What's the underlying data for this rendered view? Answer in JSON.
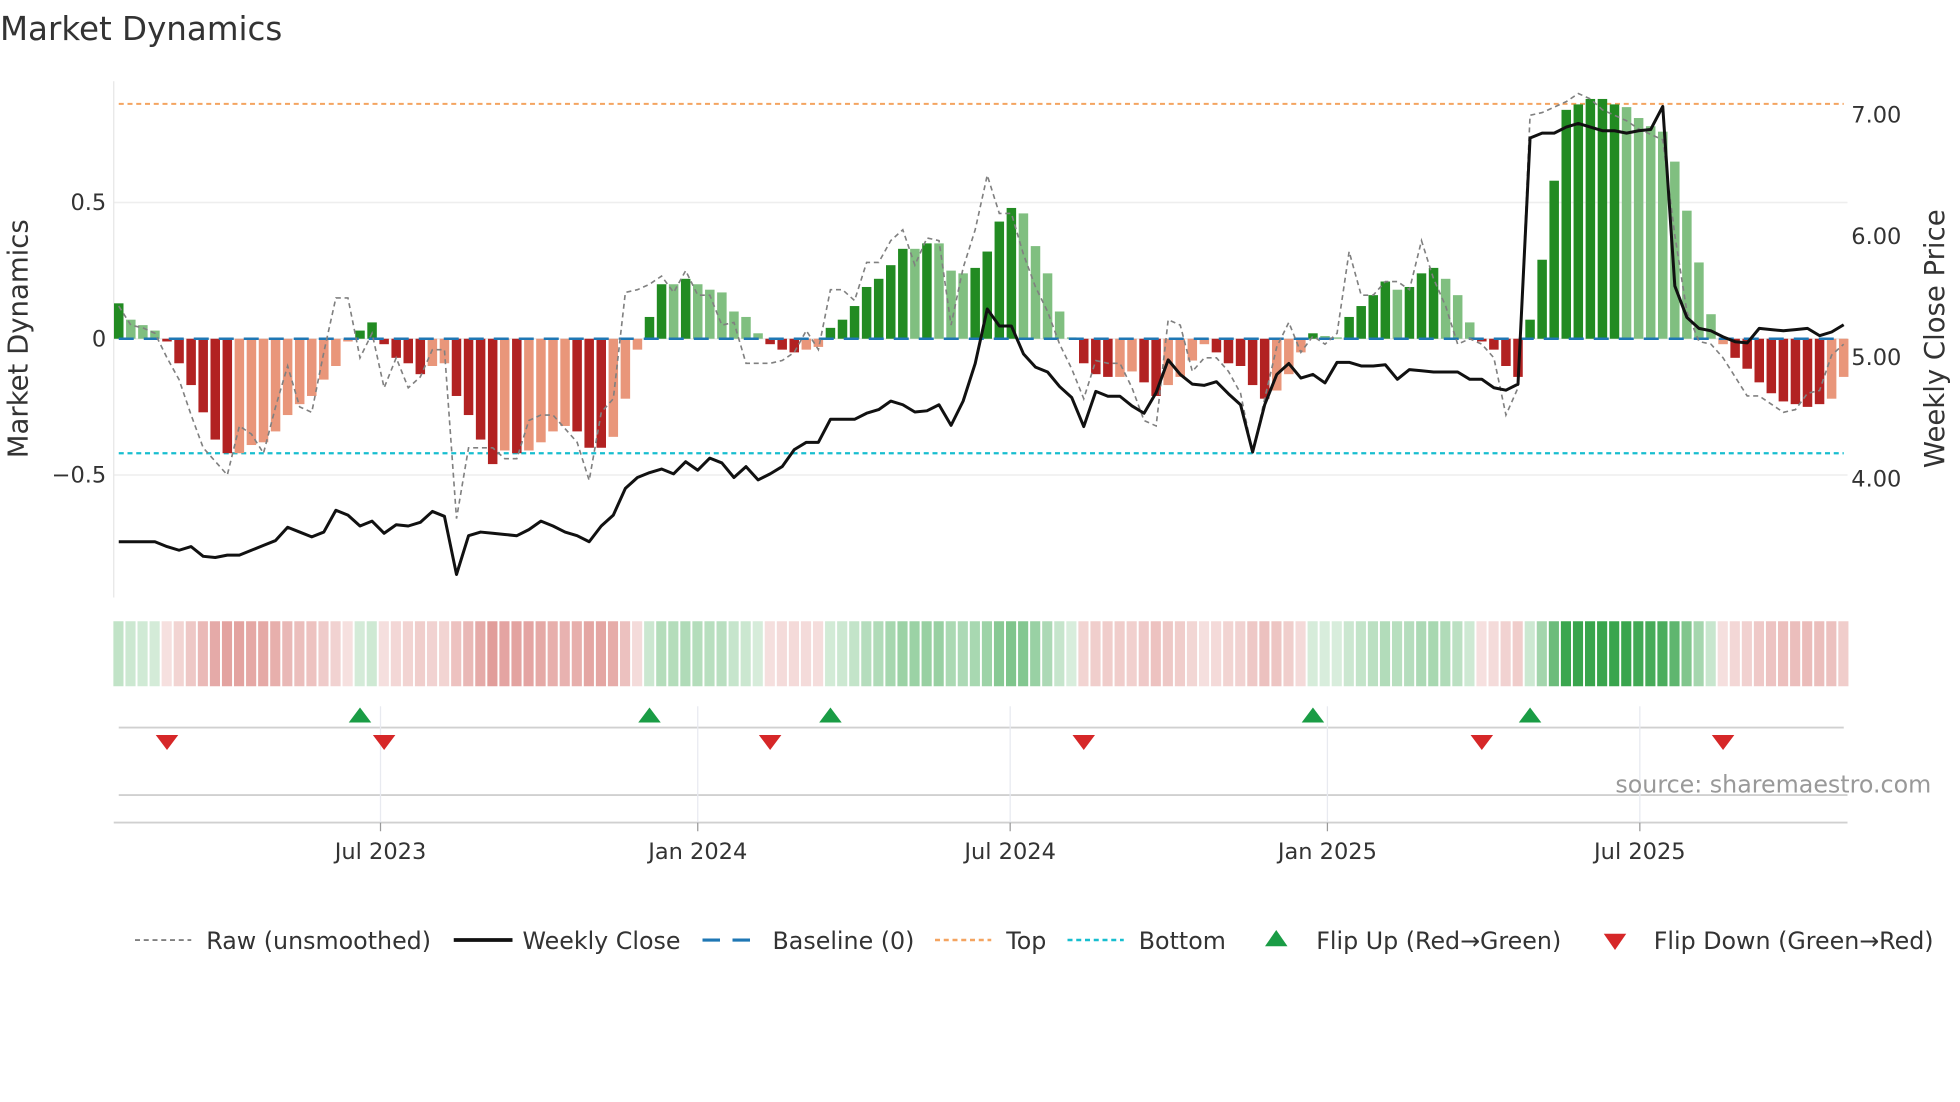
{
  "chart_data": {
    "type": "bar",
    "title": "Market Dynamics",
    "ylabel": "Market Dynamics",
    "y2label": "Weekly Close Price",
    "ylim": [
      -0.92,
      0.95
    ],
    "y2lim": [
      3.0,
      7.2
    ],
    "y_ticks": [
      {
        "value": 0.5,
        "label": "0.5"
      },
      {
        "value": 0,
        "label": "0"
      },
      {
        "value": -0.5,
        "label": "−0.5"
      }
    ],
    "y2_ticks": [
      {
        "value": 7,
        "label": "7.00"
      },
      {
        "value": 6,
        "label": "6.00"
      },
      {
        "value": 5,
        "label": "5.00"
      },
      {
        "value": 4,
        "label": "4.00"
      }
    ],
    "x_ticks": [
      {
        "week": 21.7,
        "label": "Jul 2023"
      },
      {
        "week": 48.0,
        "label": "Jan 2024"
      },
      {
        "week": 73.9,
        "label": "Jul 2024"
      },
      {
        "week": 100.2,
        "label": "Jan 2025"
      },
      {
        "week": 126.1,
        "label": "Jul 2025"
      }
    ],
    "top_level": 0.862,
    "bottom_level": -0.42,
    "baseline": 0,
    "dynamics": [
      0.13,
      0.07,
      0.05,
      0.03,
      -0.01,
      -0.09,
      -0.17,
      -0.27,
      -0.37,
      -0.42,
      -0.42,
      -0.39,
      -0.38,
      -0.34,
      -0.28,
      -0.24,
      -0.21,
      -0.15,
      -0.1,
      -0.01,
      0.03,
      0.06,
      -0.02,
      -0.07,
      -0.09,
      -0.13,
      -0.1,
      -0.09,
      -0.21,
      -0.28,
      -0.37,
      -0.46,
      -0.41,
      -0.42,
      -0.41,
      -0.38,
      -0.34,
      -0.32,
      -0.34,
      -0.4,
      -0.4,
      -0.36,
      -0.22,
      -0.04,
      0.08,
      0.2,
      0.2,
      0.22,
      0.2,
      0.18,
      0.17,
      0.1,
      0.08,
      0.02,
      -0.02,
      -0.04,
      -0.05,
      -0.04,
      -0.03,
      0.04,
      0.07,
      0.12,
      0.19,
      0.22,
      0.27,
      0.33,
      0.33,
      0.35,
      0.35,
      0.25,
      0.24,
      0.26,
      0.32,
      0.43,
      0.48,
      0.46,
      0.34,
      0.24,
      0.1,
      0.005,
      -0.09,
      -0.13,
      -0.14,
      -0.14,
      -0.12,
      -0.16,
      -0.21,
      -0.17,
      -0.14,
      -0.08,
      -0.02,
      -0.05,
      -0.09,
      -0.1,
      -0.17,
      -0.22,
      -0.19,
      -0.13,
      -0.05,
      0.02,
      0.01,
      0.005,
      0.08,
      0.12,
      0.16,
      0.21,
      0.18,
      0.19,
      0.24,
      0.26,
      0.22,
      0.16,
      0.06,
      -0.01,
      -0.04,
      -0.1,
      -0.14,
      0.07,
      0.29,
      0.58,
      0.84,
      0.86,
      0.88,
      0.88,
      0.86,
      0.85,
      0.81,
      0.78,
      0.76,
      0.65,
      0.47,
      0.28,
      0.09,
      -0.02,
      -0.07,
      -0.11,
      -0.16,
      -0.2,
      -0.23,
      -0.24,
      -0.25,
      -0.24,
      -0.22,
      -0.14
    ],
    "shade_groups": [
      "dllldddddd",
      "llllllllll",
      "ddddddlldd",
      "ddldlllldd",
      "dlllddldll",
      "lllldddlld",
      "ddddddldll",
      "lddddlllll",
      "dddllddlll",
      "ldddddllld",
      "llddddlddd",
      "llldddddddd",
      "ddddllllll",
      "lllddddddd",
      "dlll"
    ],
    "raw": [
      0.12,
      0.05,
      0.04,
      0.02,
      -0.07,
      -0.15,
      -0.28,
      -0.4,
      -0.45,
      -0.5,
      -0.32,
      -0.35,
      -0.42,
      -0.25,
      -0.1,
      -0.25,
      -0.27,
      -0.05,
      0.15,
      0.15,
      -0.07,
      0.02,
      -0.18,
      -0.07,
      -0.18,
      -0.14,
      -0.04,
      -0.04,
      -0.66,
      -0.4,
      -0.4,
      -0.4,
      -0.44,
      -0.44,
      -0.3,
      -0.28,
      -0.28,
      -0.33,
      -0.38,
      -0.52,
      -0.27,
      -0.22,
      0.17,
      0.18,
      0.2,
      0.23,
      0.17,
      0.25,
      0.16,
      0.16,
      0.05,
      0.06,
      -0.09,
      -0.09,
      -0.09,
      -0.08,
      -0.05,
      0.03,
      -0.04,
      0.18,
      0.18,
      0.14,
      0.28,
      0.28,
      0.36,
      0.4,
      0.27,
      0.37,
      0.36,
      0.05,
      0.26,
      0.4,
      0.6,
      0.46,
      0.46,
      0.31,
      0.19,
      0.1,
      -0.02,
      -0.11,
      -0.22,
      -0.08,
      -0.09,
      -0.09,
      -0.18,
      -0.3,
      -0.32,
      0.07,
      0.05,
      -0.12,
      -0.07,
      -0.07,
      -0.12,
      -0.2,
      -0.42,
      -0.22,
      -0.03,
      0.06,
      -0.05,
      0.01,
      -0.02,
      0.02,
      0.32,
      0.16,
      0.16,
      0.21,
      0.21,
      0.18,
      0.36,
      0.22,
      0.12,
      -0.02,
      0.0,
      -0.02,
      -0.07,
      -0.28,
      -0.18,
      0.82,
      0.83,
      0.85,
      0.87,
      0.9,
      0.88,
      0.84,
      0.82,
      0.8,
      0.77,
      0.75,
      0.73,
      0.38,
      0.1,
      -0.01,
      -0.02,
      -0.07,
      -0.14,
      -0.21,
      -0.21,
      -0.24,
      -0.27,
      -0.26,
      -0.2,
      -0.19,
      -0.06,
      -0.02
    ],
    "weekly_close": [
      3.47,
      3.47,
      3.47,
      3.47,
      3.43,
      3.4,
      3.43,
      3.35,
      3.34,
      3.36,
      3.36,
      3.4,
      3.44,
      3.48,
      3.59,
      3.55,
      3.51,
      3.55,
      3.73,
      3.69,
      3.6,
      3.64,
      3.54,
      3.61,
      3.6,
      3.63,
      3.72,
      3.68,
      3.2,
      3.52,
      3.55,
      3.54,
      3.53,
      3.52,
      3.57,
      3.64,
      3.6,
      3.55,
      3.52,
      3.47,
      3.6,
      3.69,
      3.91,
      4.0,
      4.04,
      4.07,
      4.03,
      4.13,
      4.06,
      4.16,
      4.12,
      4.0,
      4.09,
      3.98,
      4.03,
      4.09,
      4.23,
      4.29,
      4.29,
      4.48,
      4.48,
      4.48,
      4.53,
      4.56,
      4.63,
      4.6,
      4.54,
      4.55,
      4.6,
      4.43,
      4.63,
      4.94,
      5.39,
      5.25,
      5.25,
      5.02,
      4.91,
      4.87,
      4.75,
      4.66,
      4.42,
      4.71,
      4.67,
      4.67,
      4.59,
      4.53,
      4.7,
      4.97,
      4.85,
      4.77,
      4.76,
      4.79,
      4.69,
      4.6,
      4.21,
      4.6,
      4.85,
      4.94,
      4.82,
      4.85,
      4.78,
      4.95,
      4.95,
      4.92,
      4.92,
      4.93,
      4.81,
      4.89,
      4.88,
      4.87,
      4.87,
      4.87,
      4.81,
      4.81,
      4.74,
      4.72,
      4.77,
      6.8,
      6.84,
      6.84,
      6.89,
      6.92,
      6.89,
      6.86,
      6.86,
      6.84,
      6.86,
      6.87,
      7.06,
      5.58,
      5.32,
      5.23,
      5.21,
      5.16,
      5.12,
      5.11,
      5.23,
      5.22,
      5.21,
      5.22,
      5.23,
      5.17,
      5.2,
      5.26
    ],
    "flip_up_weeks": [
      20,
      44,
      59,
      99,
      117
    ],
    "flip_down_weeks": [
      4,
      22,
      54,
      80,
      113,
      133
    ],
    "legend": {
      "placement": "bottom",
      "raw": "Raw (unsmoothed)",
      "close": "Weekly Close",
      "baseline": "Baseline (0)",
      "top": "Top",
      "bottom": "Bottom",
      "flip_up": "Flip Up (Red→Green)",
      "flip_down": "Flip Down (Green→Red)"
    },
    "source": "source: sharemaestro.com"
  },
  "colors": {
    "green_dark": "#228b22",
    "green_light": "#80bf80",
    "red_dark": "#b22222",
    "red_light": "#e9967a",
    "top": "#f4a460",
    "bottom": "#17becf",
    "baseline": "#1f77b4",
    "raw": "#808080",
    "close": "#111111",
    "flip_up": "#1a9c45",
    "flip_down": "#d62728"
  }
}
